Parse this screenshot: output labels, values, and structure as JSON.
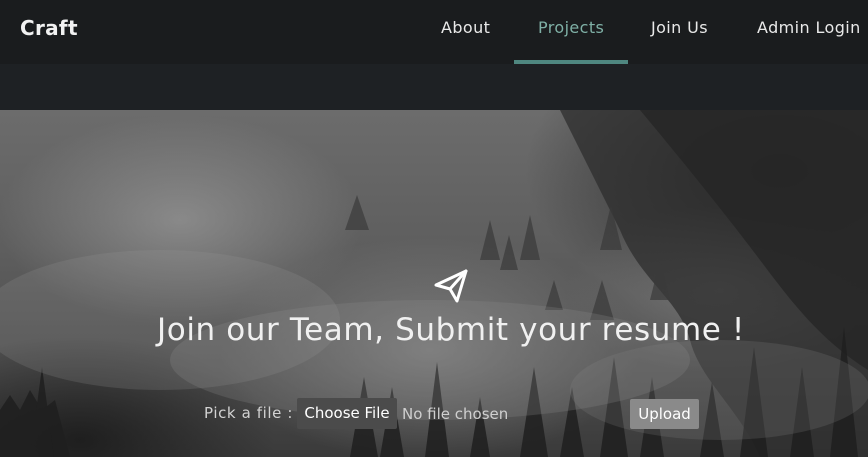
{
  "header": {
    "brand": "Craft",
    "nav": [
      {
        "label": "About",
        "active": false
      },
      {
        "label": "Projects",
        "active": true
      },
      {
        "label": "Join Us",
        "active": false
      },
      {
        "label": "Admin Login",
        "active": false
      }
    ],
    "active_color": "#7fb0a6"
  },
  "hero": {
    "icon": "paper-plane-icon",
    "headline": "Join our Team, Submit your resume !"
  },
  "upload_form": {
    "label": "Pick a file :",
    "choose_button": "Choose File",
    "file_status": "No file chosen",
    "upload_button": "Upload"
  }
}
